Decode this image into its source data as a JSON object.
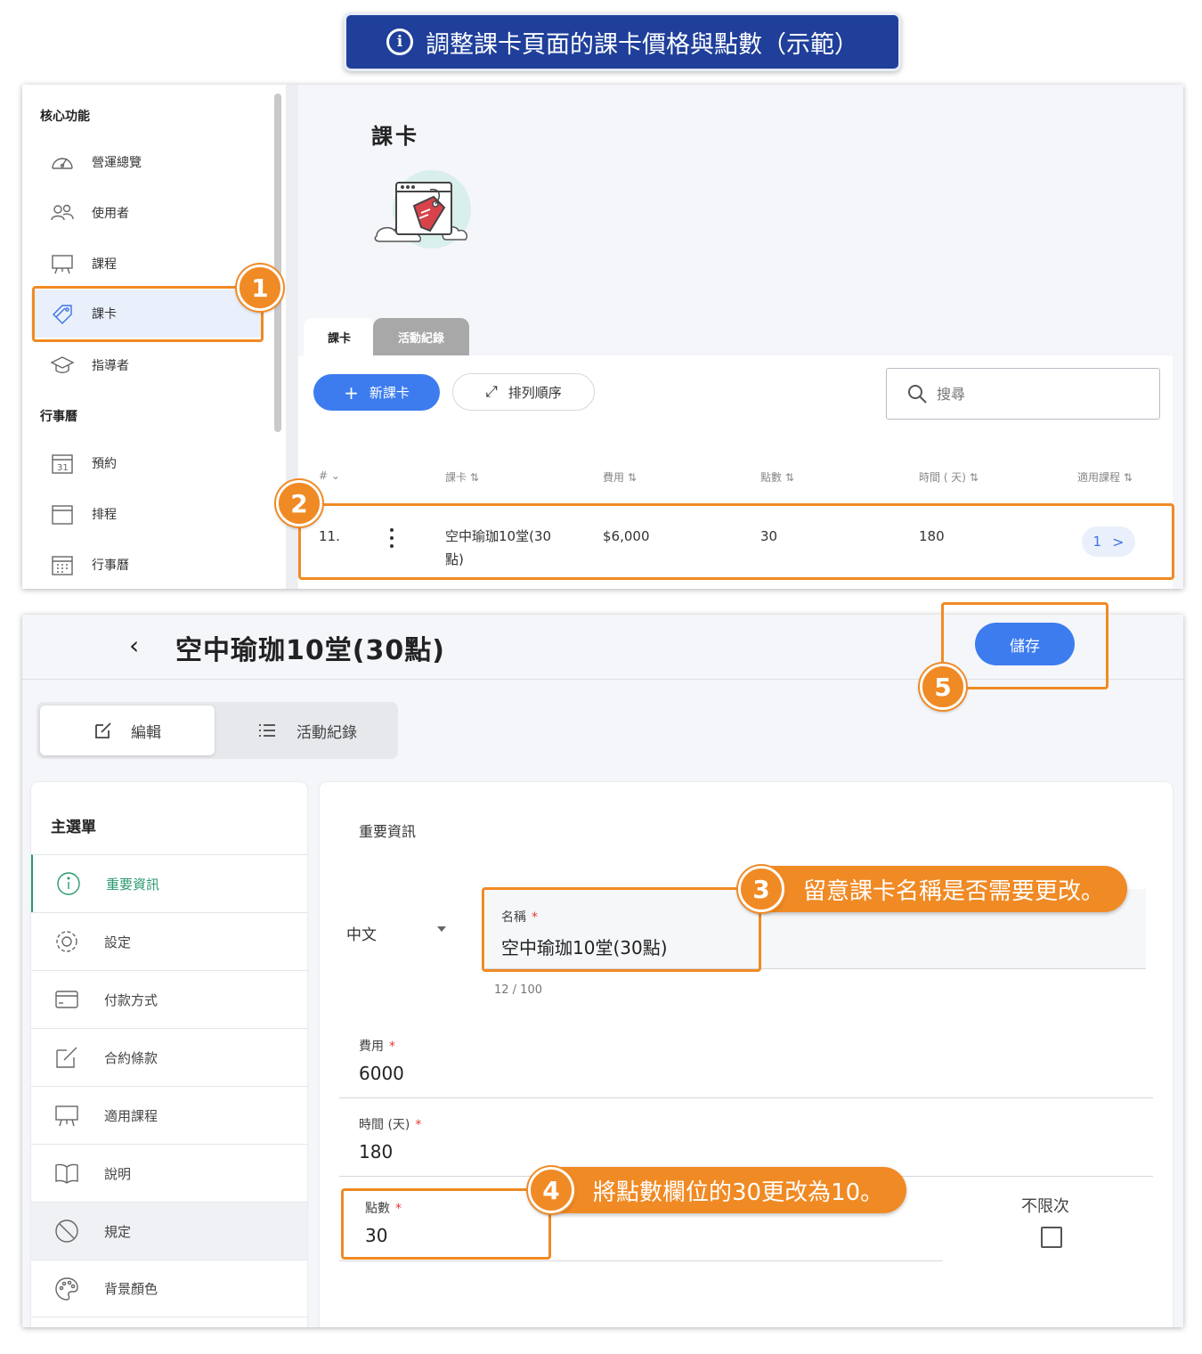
{
  "banner": {
    "info_glyph": "i",
    "text": "調整課卡頁面的課卡價格與點數（示範）"
  },
  "sidebar": {
    "section_core": "核心功能",
    "section_calendar": "行事曆",
    "items": [
      {
        "label": "營運總覽",
        "icon": "speedometer-icon"
      },
      {
        "label": "使用者",
        "icon": "users-icon"
      },
      {
        "label": "課程",
        "icon": "presentation-board-icon"
      },
      {
        "label": "課卡",
        "icon": "tag-icon"
      },
      {
        "label": "指導者",
        "icon": "graduation-cap-icon"
      },
      {
        "label": "預約",
        "icon": "calendar-31-icon"
      },
      {
        "label": "排程",
        "icon": "calendar-blank-icon"
      },
      {
        "label": "行事曆",
        "icon": "calendar-grid-icon"
      }
    ]
  },
  "cards_page": {
    "title": "課卡",
    "tabs": [
      "課卡",
      "活動紀錄"
    ],
    "new_button": "新課卡",
    "sort_button": "排列順序",
    "search_placeholder": "搜尋",
    "columns": [
      "#",
      "課卡",
      "費用",
      "點數",
      "時間 ( 天)",
      "適用課程"
    ],
    "row": {
      "index": "11.",
      "name_line1": "空中瑜珈10堂(30",
      "name_line2": "點)",
      "price": "$6,000",
      "points": "30",
      "days": "180",
      "courses_count": "1"
    }
  },
  "edit_page": {
    "title": "空中瑜珈10堂(30點)",
    "save_button": "儲存",
    "seg_edit": "編輯",
    "seg_log": "活動紀錄",
    "menu_title": "主選單",
    "menu_items": [
      {
        "label": "重要資訊",
        "icon": "info-icon"
      },
      {
        "label": "設定",
        "icon": "gear-icon"
      },
      {
        "label": "付款方式",
        "icon": "credit-card-icon"
      },
      {
        "label": "合約條款",
        "icon": "edit-document-icon"
      },
      {
        "label": "適用課程",
        "icon": "presentation-board-icon"
      },
      {
        "label": "說明",
        "icon": "open-book-icon"
      },
      {
        "label": "規定",
        "icon": "prohibited-icon"
      },
      {
        "label": "背景顏色",
        "icon": "palette-icon"
      }
    ],
    "section_title": "重要資訊",
    "language": "中文",
    "name_label": "名稱",
    "name_value": "空中瑜珈10堂(30點)",
    "name_counter": "12 / 100",
    "price_label": "費用",
    "price_value": "6000",
    "days_label": "時間 (天)",
    "days_value": "180",
    "points_label": "點數",
    "points_value": "30",
    "unlimited_label": "不限次",
    "required_mark": "*"
  },
  "annotations": {
    "n1": "1",
    "n2": "2",
    "n3": "3",
    "n4": "4",
    "n5": "5",
    "callout3": "留意課卡名稱是否需要更改。",
    "callout4": "將點數欄位的30更改為10。"
  },
  "colors": {
    "accent_blue": "#3d7cef",
    "banner_navy": "#1f3f9a",
    "annotation_orange": "#f08a24",
    "active_green": "#2a9a6d"
  }
}
